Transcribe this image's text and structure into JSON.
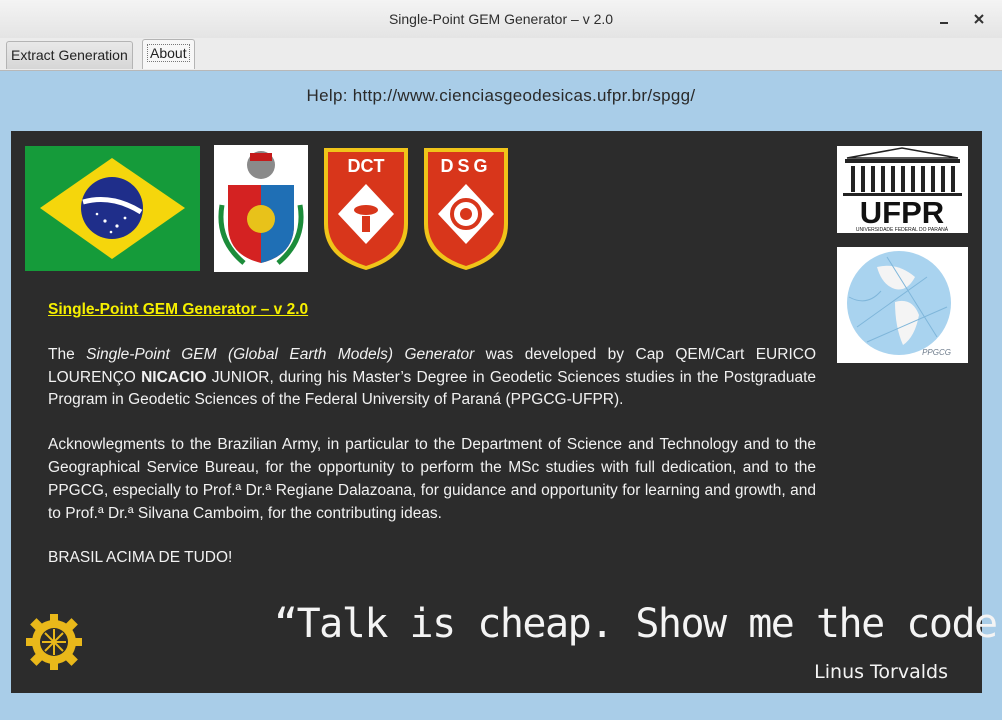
{
  "window": {
    "title": "Single-Point GEM Generator – v 2.0",
    "minimize_icon": "minimize-icon",
    "close_icon": "close-icon"
  },
  "tabs": [
    {
      "label": "Extract Generation"
    },
    {
      "label": "About"
    }
  ],
  "help": {
    "text": "Help:  http://www.cienciasgeodesicas.ufpr.br/spgg/"
  },
  "logos": {
    "dct_text": "DCT",
    "dsg_text": "DSG",
    "ufpr_text": "UFPR",
    "ufpr_sub": "UNIVERSIDADE FEDERAL DO PARANÁ",
    "ppgcg_text": "PPGCG"
  },
  "about": {
    "heading": "Single-Point GEM Generator – v 2.0",
    "p1": {
      "a": "The ",
      "b": "Single-Point GEM (Global Earth Models) Generator",
      "c": " was developed by Cap QEM/Cart EURICO LOURENÇO ",
      "d": "NICACIO",
      "e": " JUNIOR, during his Master’s Degree in Geodetic Sciences studies in the Postgraduate Program in Geodetic Sciences of the Federal University of Paraná (PPGCG-UFPR)."
    },
    "p2": "Acknowlegments to the Brazilian Army, in particular to the Department of Science and Technology and to the Geographical Service Bureau, for the opportunity to perform the MSc studies with full dedication, and to the PPGCG, especially to Prof.ª Dr.ª Regiane Dalazoana, for guidance and opportunity for learning and growth, and to Prof.ª Dr.ª Silvana Camboim, for the contributing ideas.",
    "p3": "BRASIL ACIMA DE TUDO!"
  },
  "quote": {
    "text": "“Talk is cheap. Show me the code.”",
    "author": "Linus Torvalds"
  }
}
